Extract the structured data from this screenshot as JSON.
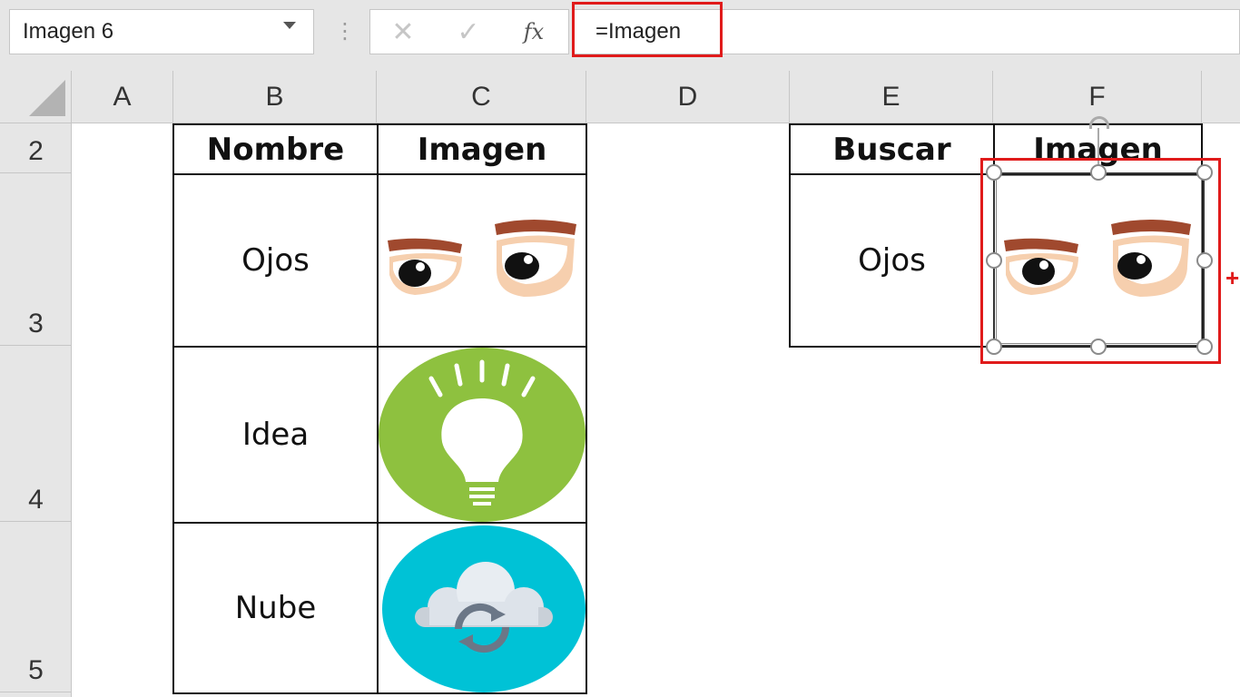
{
  "formula_bar": {
    "name_box": "Imagen 6",
    "separator": "⋮",
    "cancel_icon": "✕",
    "confirm_icon": "✓",
    "fx_label": "fx",
    "formula": "=Imagen"
  },
  "columns": [
    "A",
    "B",
    "C",
    "D",
    "E",
    "F"
  ],
  "rows": [
    "2",
    "3",
    "4",
    "5"
  ],
  "table_left": {
    "headers": [
      "Nombre",
      "Imagen"
    ],
    "rows": [
      {
        "name": "Ojos",
        "image": "eyes-image"
      },
      {
        "name": "Idea",
        "image": "lightbulb-image"
      },
      {
        "name": "Nube",
        "image": "cloud-sync-image"
      }
    ]
  },
  "table_right": {
    "headers": [
      "Buscar",
      "Imagen"
    ],
    "search_value": "Ojos",
    "result_image": "eyes-image"
  },
  "colors": {
    "highlight": "#e01b1b",
    "idea_green": "#8ec13f",
    "cloud_cyan": "#00c2d6"
  }
}
